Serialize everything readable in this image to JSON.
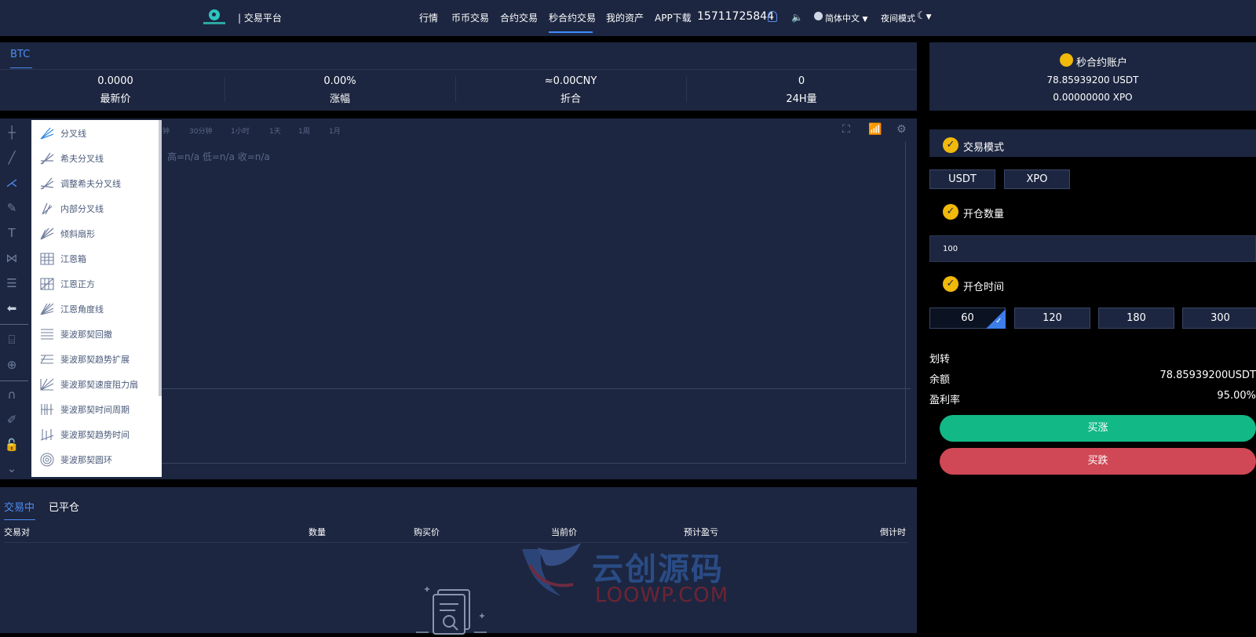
{
  "header": {
    "platform": "| 交易平台",
    "nav": [
      "行情",
      "币币交易",
      "合约交易",
      "秒合约交易",
      "我的资产",
      "APP下载"
    ],
    "phone": "15711725844",
    "language": "简体中文",
    "night_mode": "夜间模式"
  },
  "ticker": {
    "symbol_tab": "BTC",
    "stats": [
      {
        "value": "0.0000",
        "label": "最新价"
      },
      {
        "value": "0.00%",
        "label": "涨幅"
      },
      {
        "value": "≈0.00CNY",
        "label": "折合"
      },
      {
        "value": "0",
        "label": "24H量"
      }
    ]
  },
  "chart": {
    "intervals": [
      "钟",
      "30分钟",
      "1小时",
      "1天",
      "1周",
      "1月"
    ],
    "ohlc": "高=n/a  低=n/a  收=n/a",
    "drawing_menu": [
      "分叉线",
      "希夫分叉线",
      "调整希夫分叉线",
      "内部分叉线",
      "倾斜扇形",
      "江恩箱",
      "江恩正方",
      "江恩角度线",
      "斐波那契回撤",
      "斐波那契趋势扩展",
      "斐波那契速度阻力扇",
      "斐波那契时间周期",
      "斐波那契趋势时间",
      "斐波那契圆环"
    ]
  },
  "orders": {
    "tabs": [
      "交易中",
      "已平仓"
    ],
    "columns": [
      "交易对",
      "数量",
      "购买价",
      "当前价",
      "预计盈亏",
      "倒计时"
    ]
  },
  "watermark": {
    "cn": "云创源码",
    "en": "LOOWP.COM"
  },
  "account": {
    "title": "秒合约账户",
    "usdt": "78.85939200 USDT",
    "xpo": "0.00000000 XPO"
  },
  "trade": {
    "mode_title": "交易模式",
    "modes": [
      "USDT",
      "XPO"
    ],
    "qty_title": "开仓数量",
    "qty_value": "100",
    "time_title": "开仓时间",
    "times": [
      "60",
      "120",
      "180",
      "300"
    ],
    "transfer": "划转",
    "balance_label": "余额",
    "balance_value": "78.85939200USDT",
    "profit_label": "盈利率",
    "profit_value": "95.00%",
    "buy_up": "买涨",
    "buy_down": "买跌"
  }
}
